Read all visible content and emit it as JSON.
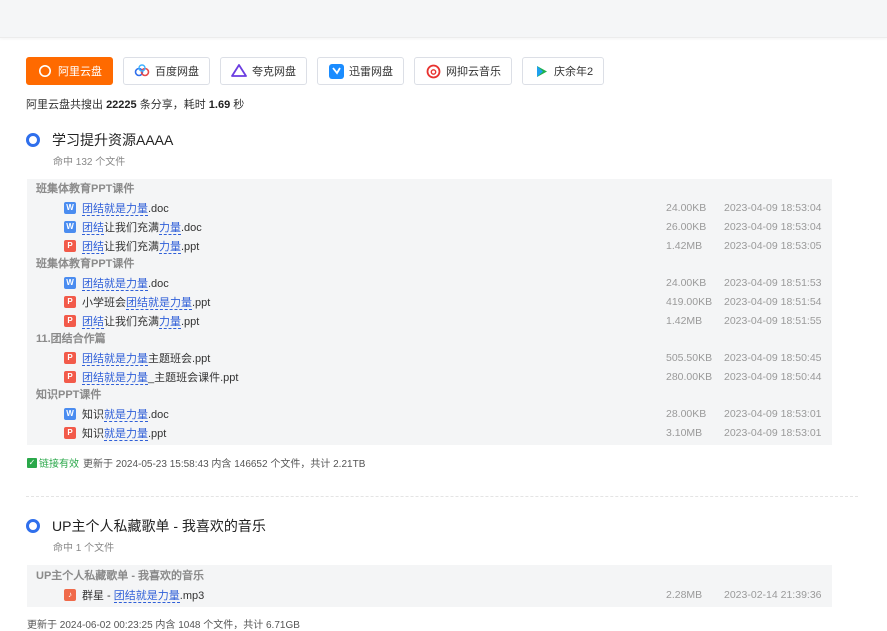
{
  "tabs": [
    {
      "label": "阿里云盘",
      "icon": "aliyun-icon",
      "active": true
    },
    {
      "label": "百度网盘",
      "icon": "baidu-icon",
      "active": false
    },
    {
      "label": "夸克网盘",
      "icon": "quark-icon",
      "active": false
    },
    {
      "label": "迅雷网盘",
      "icon": "xunlei-icon",
      "active": false
    },
    {
      "label": "网抑云音乐",
      "icon": "netease-music-icon",
      "active": false
    },
    {
      "label": "庆余年2",
      "icon": "play-icon",
      "active": false
    }
  ],
  "summary": {
    "prefix": "阿里云盘共搜出 ",
    "count": "22225",
    "mid": " 条分享，耗时 ",
    "time": "1.69",
    "suffix": " 秒"
  },
  "results": [
    {
      "title": "学习提升资源AAAA",
      "hits": "命中 132 个文件",
      "folders": [
        {
          "name": "班集体教育PPT课件",
          "files": [
            {
              "type": "doc",
              "parts": [
                [
                  "团结就是力量",
                  true
                ],
                [
                  ".doc",
                  false
                ]
              ],
              "size": "24.00KB",
              "time": "2023-04-09 18:53:04"
            },
            {
              "type": "doc",
              "parts": [
                [
                  "团结",
                  true
                ],
                [
                  "让我们充满",
                  false
                ],
                [
                  "力量",
                  true
                ],
                [
                  ".doc",
                  false
                ]
              ],
              "size": "26.00KB",
              "time": "2023-04-09 18:53:04"
            },
            {
              "type": "ppt",
              "parts": [
                [
                  "团结",
                  true
                ],
                [
                  "让我们充满",
                  false
                ],
                [
                  "力量",
                  true
                ],
                [
                  ".ppt",
                  false
                ]
              ],
              "size": "1.42MB",
              "time": "2023-04-09 18:53:05"
            }
          ]
        },
        {
          "name": "班集体教育PPT课件",
          "files": [
            {
              "type": "doc",
              "parts": [
                [
                  "团结就是力量",
                  true
                ],
                [
                  ".doc",
                  false
                ]
              ],
              "size": "24.00KB",
              "time": "2023-04-09 18:51:53"
            },
            {
              "type": "ppt",
              "parts": [
                [
                  "小学班会",
                  false
                ],
                [
                  "团结就是力量",
                  true
                ],
                [
                  ".ppt",
                  false
                ]
              ],
              "size": "419.00KB",
              "time": "2023-04-09 18:51:54"
            },
            {
              "type": "ppt",
              "parts": [
                [
                  "团结",
                  true
                ],
                [
                  "让我们充满",
                  false
                ],
                [
                  "力量",
                  true
                ],
                [
                  ".ppt",
                  false
                ]
              ],
              "size": "1.42MB",
              "time": "2023-04-09 18:51:55"
            }
          ]
        },
        {
          "name": "11.团结合作篇",
          "files": [
            {
              "type": "ppt",
              "parts": [
                [
                  "团结就是力量",
                  true
                ],
                [
                  "主题班会.ppt",
                  false
                ]
              ],
              "size": "505.50KB",
              "time": "2023-04-09 18:50:45"
            },
            {
              "type": "ppt",
              "parts": [
                [
                  "团结就是力量",
                  true
                ],
                [
                  "_主题班会课件.ppt",
                  false
                ]
              ],
              "size": "280.00KB",
              "time": "2023-04-09 18:50:44"
            }
          ]
        },
        {
          "name": "知识PPT课件",
          "files": [
            {
              "type": "doc",
              "parts": [
                [
                  "知识",
                  false
                ],
                [
                  "就是力量",
                  true
                ],
                [
                  ".doc",
                  false
                ]
              ],
              "size": "28.00KB",
              "time": "2023-04-09 18:53:01"
            },
            {
              "type": "ppt",
              "parts": [
                [
                  "知识",
                  false
                ],
                [
                  "就是力量",
                  true
                ],
                [
                  ".ppt",
                  false
                ]
              ],
              "size": "3.10MB",
              "time": "2023-04-09 18:53:01"
            }
          ]
        }
      ],
      "status_valid": "链接有效",
      "status": "更新于 2024-05-23 15:58:43 内含 146652 个文件，共计 2.21TB"
    },
    {
      "title": "UP主个人私藏歌单 - 我喜欢的音乐",
      "hits": "命中 1 个文件",
      "folders": [
        {
          "name": "UP主个人私藏歌单 - 我喜欢的音乐",
          "files": [
            {
              "type": "mp3",
              "parts": [
                [
                  "群星 - ",
                  false
                ],
                [
                  "团结就是力量",
                  true
                ],
                [
                  ".mp3",
                  false
                ]
              ],
              "size": "2.28MB",
              "time": "2023-02-14 21:39:36"
            }
          ]
        }
      ],
      "status_valid": "",
      "status": "更新于 2024-06-02 00:23:25 内含 1048 个文件，共计 6.71GB"
    }
  ]
}
